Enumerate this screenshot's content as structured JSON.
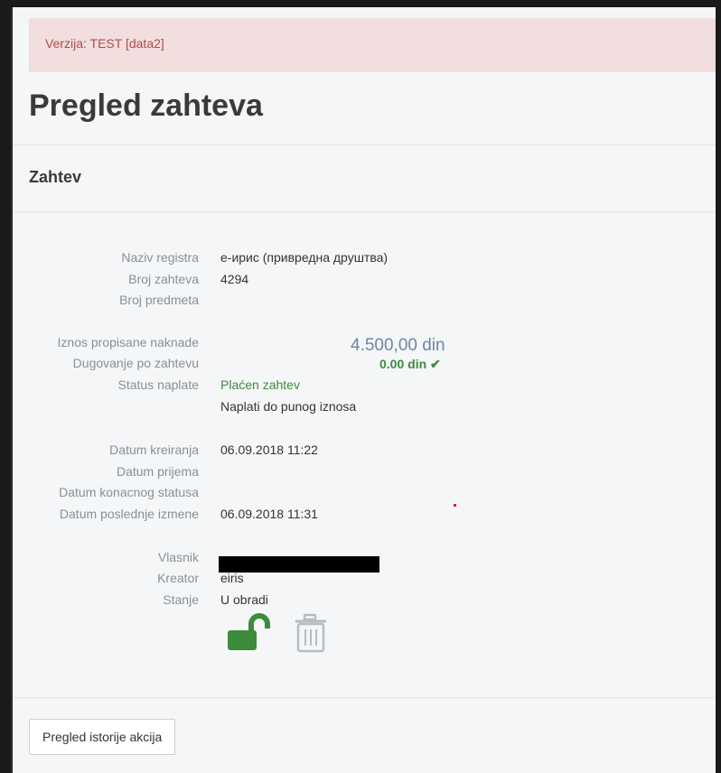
{
  "banner": {
    "text": "Verzija: TEST [data2]"
  },
  "page": {
    "title": "Pregled zahteva"
  },
  "panel": {
    "title": "Zahtev"
  },
  "fields": {
    "naziv_registra": {
      "label": "Naziv registra",
      "value": "е-ирис (привредна друштва)"
    },
    "broj_zahteva": {
      "label": "Broj zahteva",
      "value": "4294"
    },
    "broj_predmeta": {
      "label": "Broj predmeta",
      "value": ""
    },
    "iznos": {
      "label": "Iznos propisane naknade",
      "value": "4.500,00 din"
    },
    "dugovanje": {
      "label": "Dugovanje po zahtevu",
      "value": "0.00 din ✔"
    },
    "status_naplate": {
      "label": "Status naplate",
      "value": "Plaćen zahtev",
      "note": "Naplati do punog iznosa"
    },
    "datum_kreiranja": {
      "label": "Datum kreiranja",
      "value": "06.09.2018 11:22"
    },
    "datum_prijema": {
      "label": "Datum prijema",
      "value": ""
    },
    "datum_konacnog": {
      "label": "Datum konacnog statusa",
      "value": ""
    },
    "datum_izmene": {
      "label": "Datum poslednje izmene",
      "value": "06.09.2018 11:31"
    },
    "vlasnik": {
      "label": "Vlasnik",
      "value": ""
    },
    "kreator": {
      "label": "Kreator",
      "value": "eiris"
    },
    "stanje": {
      "label": "Stanje",
      "value": "U obradi"
    }
  },
  "actions": {
    "unlock_icon": "unlock-icon",
    "delete_icon": "trash-icon",
    "history_button": "Pregled istorije akcija"
  },
  "colors": {
    "success": "#3d8b3d",
    "alert_bg": "#f2dede",
    "alert_text": "#b24a4a",
    "amount": "#6a86aa"
  }
}
